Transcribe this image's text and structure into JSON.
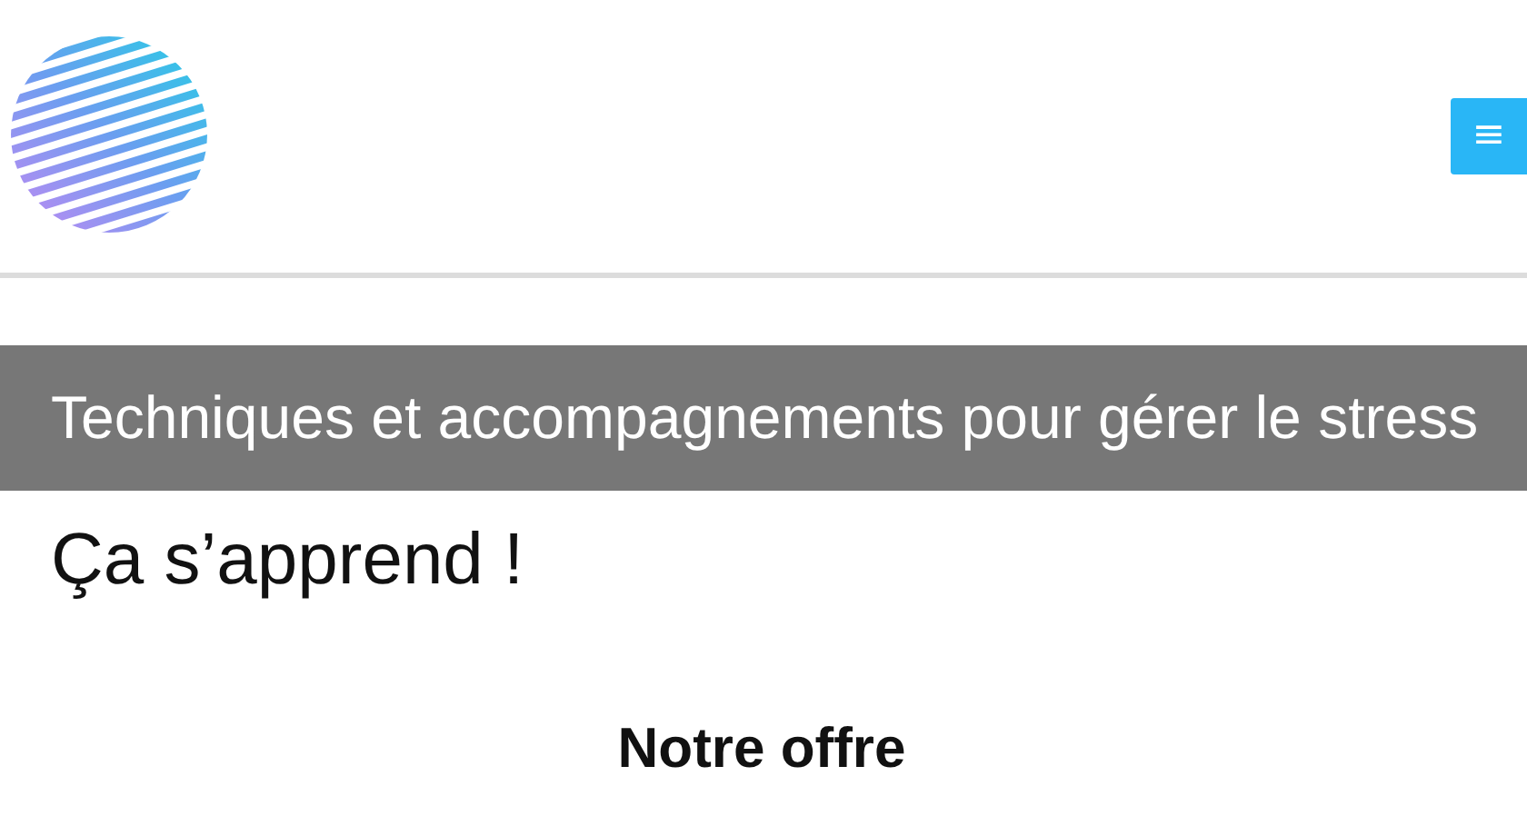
{
  "header": {
    "menu_button": "≡"
  },
  "hero": {
    "subtitle": "Techniques et accompagnements pour gérer le stress",
    "tagline": "Ça s’apprend !"
  },
  "section": {
    "heading": "Notre offre"
  }
}
